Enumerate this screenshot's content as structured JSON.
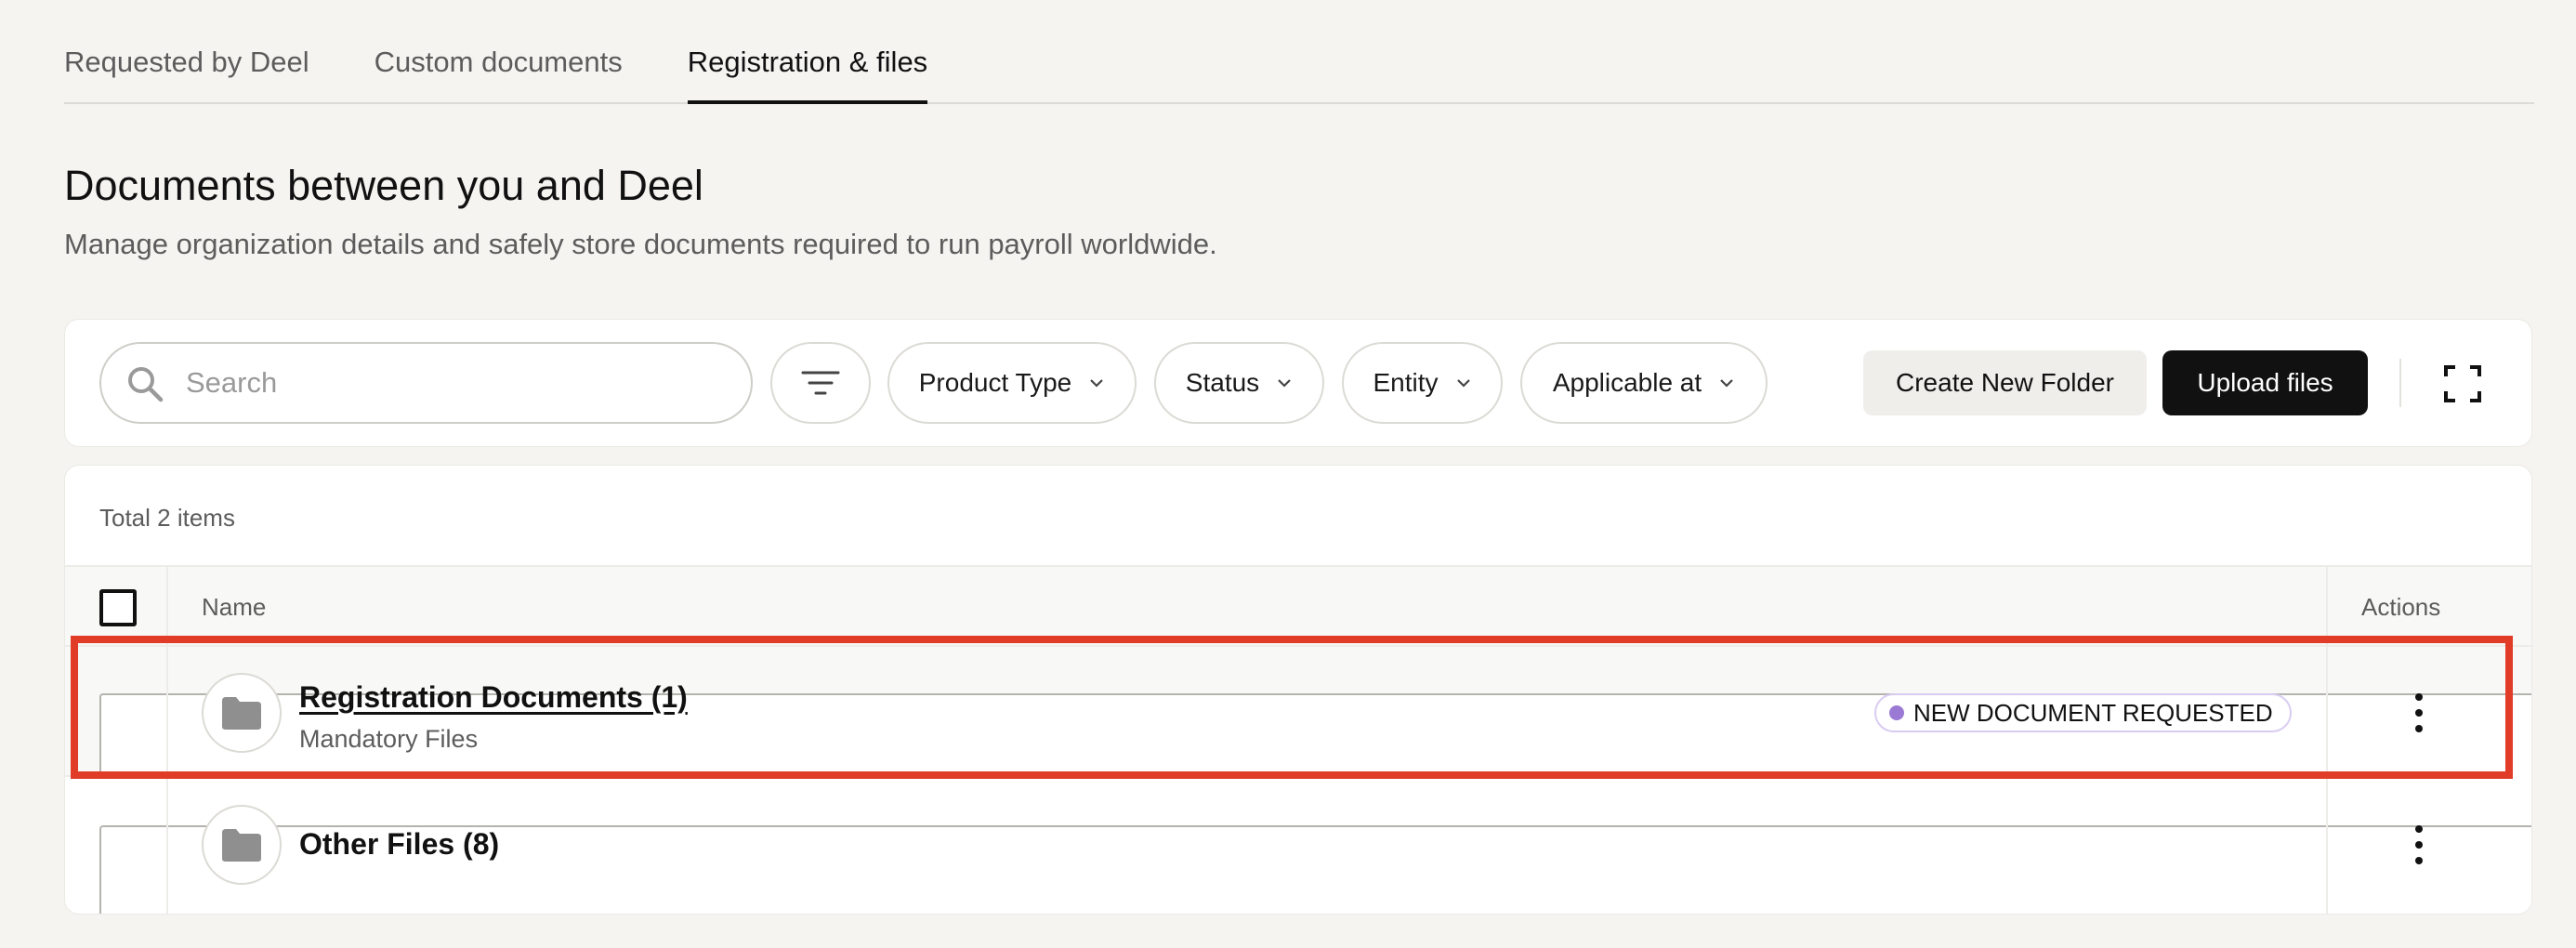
{
  "tabs": [
    {
      "label": "Requested by Deel"
    },
    {
      "label": "Custom documents"
    },
    {
      "label": "Registration & files",
      "active": true
    }
  ],
  "header": {
    "title": "Documents between you and Deel",
    "subtitle": "Manage organization details and safely store documents required to run payroll worldwide."
  },
  "filters": {
    "search_placeholder": "Search",
    "product_type": "Product Type",
    "status": "Status",
    "entity": "Entity",
    "applicable_at": "Applicable at",
    "create_folder_label": "Create New Folder",
    "upload_label": "Upload files"
  },
  "table": {
    "total_label": "Total 2 items",
    "columns": {
      "name": "Name",
      "actions": "Actions"
    },
    "rows": [
      {
        "title": "Registration Documents (1)",
        "subtitle": "Mandatory Files",
        "badge": "NEW DOCUMENT REQUESTED",
        "highlighted": true
      },
      {
        "title": "Other Files (8)"
      }
    ]
  },
  "colors": {
    "primary_button": "#111111",
    "badge_dot": "#9b7ad6",
    "highlight_border": "#e03c28",
    "page_background": "#f5f4f1"
  }
}
